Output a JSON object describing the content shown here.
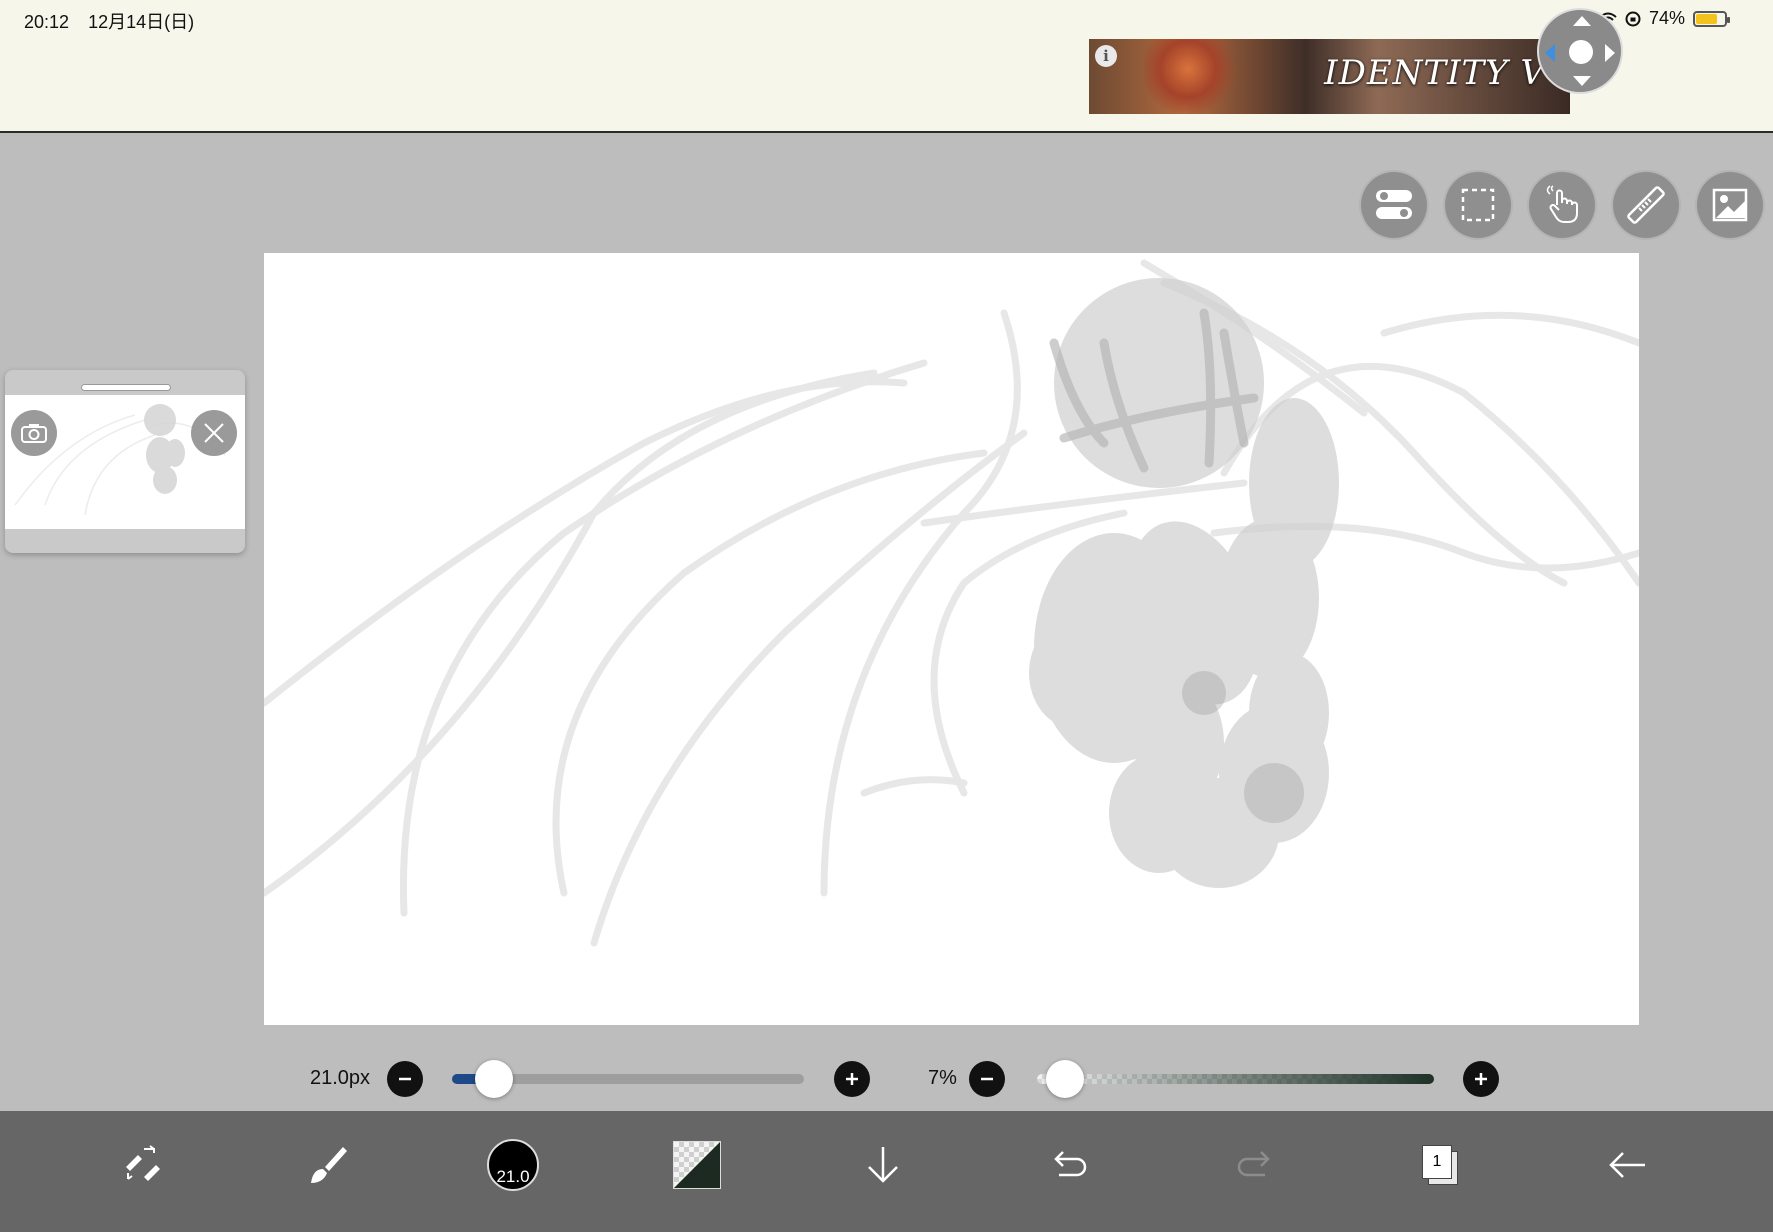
{
  "status_bar": {
    "time": "20:12",
    "date": "12月14日(日)",
    "battery": "74%"
  },
  "ad": {
    "info_icon": "i",
    "brand_text": "IDENTITY V"
  },
  "floating_joystick": {
    "icon": "dpad-joystick-icon"
  },
  "top_tools": [
    {
      "name": "toggle-settings",
      "icon": "toggle-icon"
    },
    {
      "name": "selection",
      "icon": "marquee-select-icon"
    },
    {
      "name": "hand",
      "icon": "hand-touch-icon"
    },
    {
      "name": "ruler",
      "icon": "ruler-icon"
    },
    {
      "name": "material",
      "icon": "image-icon"
    }
  ],
  "reference_window": {
    "camera_icon": "camera-icon",
    "close_icon": "close-icon"
  },
  "brush_controls": {
    "size_label": "21.0px",
    "size_fraction": 0.12,
    "opacity_label": "7%",
    "opacity_fraction": 0.07,
    "minus": "−",
    "plus": "+"
  },
  "bottom_toolbar": {
    "brush_size_value": "21.0",
    "layer_count": "1",
    "primary_color": "#1d2a22",
    "items": [
      "transform-icon",
      "brush-icon",
      "brush-size",
      "color",
      "download-icon",
      "undo-icon",
      "redo-icon",
      "layers",
      "back-icon"
    ]
  }
}
